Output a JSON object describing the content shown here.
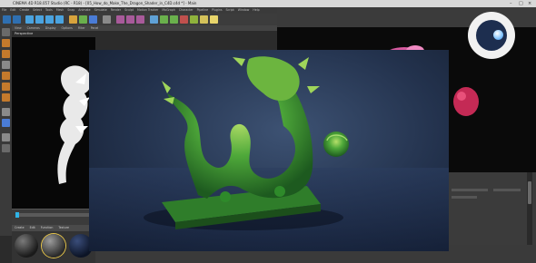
{
  "window": {
    "title": "CINEMA 4D R18.057 Studio (RC - R18) - [05_How_do_Make_The_Dragon_Shader_in_C4D.c4d *] - Main"
  },
  "menubar": {
    "items": [
      "File",
      "Edit",
      "Create",
      "Select",
      "Tools",
      "Mesh",
      "Snap",
      "Animate",
      "Simulate",
      "Render",
      "Sculpt",
      "Motion Tracker",
      "MoGraph",
      "Character",
      "Pipeline",
      "Plugins",
      "Script",
      "Window",
      "Help"
    ]
  },
  "viewport_menu": {
    "items": [
      "View",
      "Cameras",
      "Display",
      "Options",
      "Filter",
      "Panel"
    ]
  },
  "viewport": {
    "label": "Perspective"
  },
  "material_tabs": {
    "items": [
      "Create",
      "Edit",
      "Function",
      "Texture"
    ]
  },
  "colors": {
    "accent": "#2fb3e6",
    "dragon_green": "#2e8a2a",
    "background_blue": "#2a3b58"
  },
  "icons": {
    "logo": "cinema4d-logo-icon",
    "window_controls": [
      "minimize-icon",
      "maximize-icon",
      "close-icon"
    ]
  }
}
